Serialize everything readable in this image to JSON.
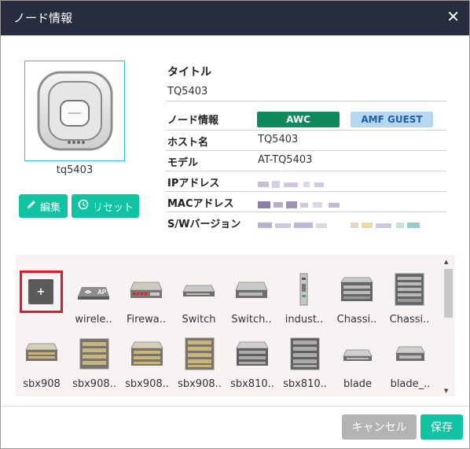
{
  "dialog": {
    "title": "ノード情報",
    "close_label": "✕"
  },
  "device": {
    "name": "tq5403"
  },
  "actions": {
    "edit_label": "編集",
    "reset_label": "リセット"
  },
  "info": {
    "title_label": "タイトル",
    "title_value": "TQ5403",
    "node_info_label": "ノード情報",
    "badges": [
      "AWC",
      "AMF GUEST"
    ],
    "host_label": "ホスト名",
    "host_value": "TQ5403",
    "model_label": "モデル",
    "model_value": "AT-TQ5403",
    "ip_label": "IPアドレス",
    "mac_label": "MACアドレス",
    "sw_label": "S/Wバージョン"
  },
  "gallery": {
    "add_label": "+",
    "items": [
      {
        "label": "wirele..",
        "icon": "wireless-ap-icon"
      },
      {
        "label": "Firewa..",
        "icon": "firewall-icon"
      },
      {
        "label": "Switch",
        "icon": "switch-icon"
      },
      {
        "label": "Switch..",
        "icon": "switch-icon"
      },
      {
        "label": "indust..",
        "icon": "industrial-switch-icon"
      },
      {
        "label": "Chassi..",
        "icon": "chassis-icon"
      },
      {
        "label": "Chassi..",
        "icon": "chassis-tall-icon"
      },
      {
        "label": "sbx908",
        "icon": "sbx908-icon"
      },
      {
        "label": "sbx908..",
        "icon": "sbx908-icon"
      },
      {
        "label": "sbx908..",
        "icon": "sbx908-icon"
      },
      {
        "label": "sbx908..",
        "icon": "sbx908-icon"
      },
      {
        "label": "sbx810..",
        "icon": "sbx8100-icon"
      },
      {
        "label": "sbx810..",
        "icon": "sbx8100-icon"
      },
      {
        "label": "blade",
        "icon": "blade-icon"
      },
      {
        "label": "blade_..",
        "icon": "blade-icon"
      }
    ]
  },
  "footer": {
    "cancel_label": "キャンセル",
    "save_label": "保存"
  },
  "colors": {
    "header": "#282d3f",
    "teal": "#12c3a3",
    "awc": "#0e8a5c",
    "amf": "#b6d6f2",
    "highlight": "#e0192a"
  }
}
